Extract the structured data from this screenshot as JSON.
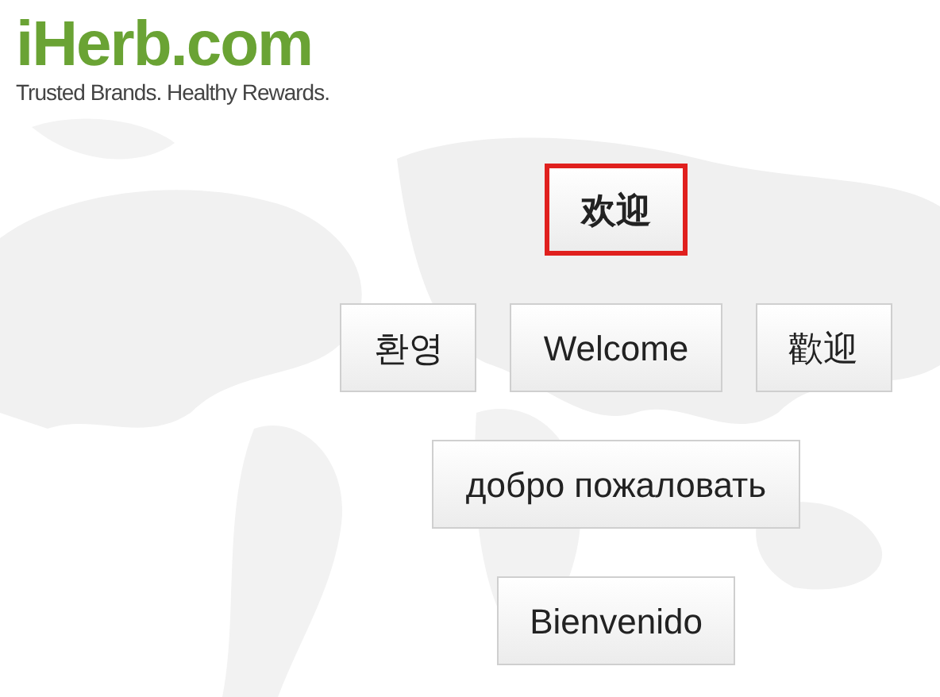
{
  "logo": {
    "name": "iHerb.com",
    "tagline": "Trusted Brands. Healthy Rewards."
  },
  "greeting_rows": [
    [
      {
        "label": "欢迎",
        "selected": true
      }
    ],
    [
      {
        "label": "환영",
        "selected": false
      },
      {
        "label": "Welcome",
        "selected": false
      },
      {
        "label": "歡迎",
        "selected": false
      }
    ],
    [
      {
        "label": "добро пожаловать",
        "selected": false
      }
    ],
    [
      {
        "label": "Bienvenido",
        "selected": false
      }
    ]
  ]
}
